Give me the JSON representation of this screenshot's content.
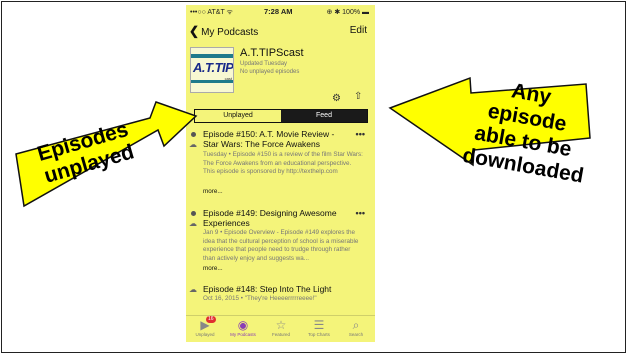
{
  "status": {
    "carrier": "•••○○ AT&T ᯤ",
    "time": "7:28 AM",
    "battery": "⊕ ✱ 100% ▬"
  },
  "nav": {
    "back_label": "My Podcasts",
    "edit_label": "Edit"
  },
  "podcast": {
    "logo_text": "A.T.TIPS",
    "logo_sub": "cast",
    "title": "A.T.TIPScast",
    "updated": "Updated Tuesday",
    "unplayed": "No unplayed episodes"
  },
  "segment": {
    "left": "Unplayed",
    "right": "Feed"
  },
  "episodes": [
    {
      "title": "Episode #150: A.T. Movie Review - Star Wars: The Force Awakens",
      "desc": "Tuesday • Episode #150 is a review of the film Star Wars: The Force Awakens from an educational perspective. This episode is sponsored by http://texthelp.com",
      "more": "more..."
    },
    {
      "title": "Episode #149: Designing Awesome Experiences",
      "desc": "Jan 9 • Episode Overview - Episode #149 explores the idea that the cultural perception of school is a miserable experience that people need to trudge through rather than actively enjoy and suggests wa...",
      "more": "more..."
    },
    {
      "title": "Episode #148: Step Into The Light",
      "desc": "Oct 16, 2015 • \"They're Heeeerrrrreeee!\"",
      "more": ""
    }
  ],
  "tabs": [
    {
      "label": "Unplayed",
      "icon": "play-circle-icon",
      "badge": "16"
    },
    {
      "label": "My Podcasts",
      "icon": "podcast-icon"
    },
    {
      "label": "Featured",
      "icon": "star-icon"
    },
    {
      "label": "Top Charts",
      "icon": "list-icon"
    },
    {
      "label": "Search",
      "icon": "search-icon"
    }
  ],
  "callouts": {
    "left": "Episodes unplayed",
    "right": "Any episode able to be downloaded"
  },
  "colors": {
    "highlight": "#f4f47a",
    "callout": "#ffff00",
    "active_tab": "#8a3db5"
  }
}
